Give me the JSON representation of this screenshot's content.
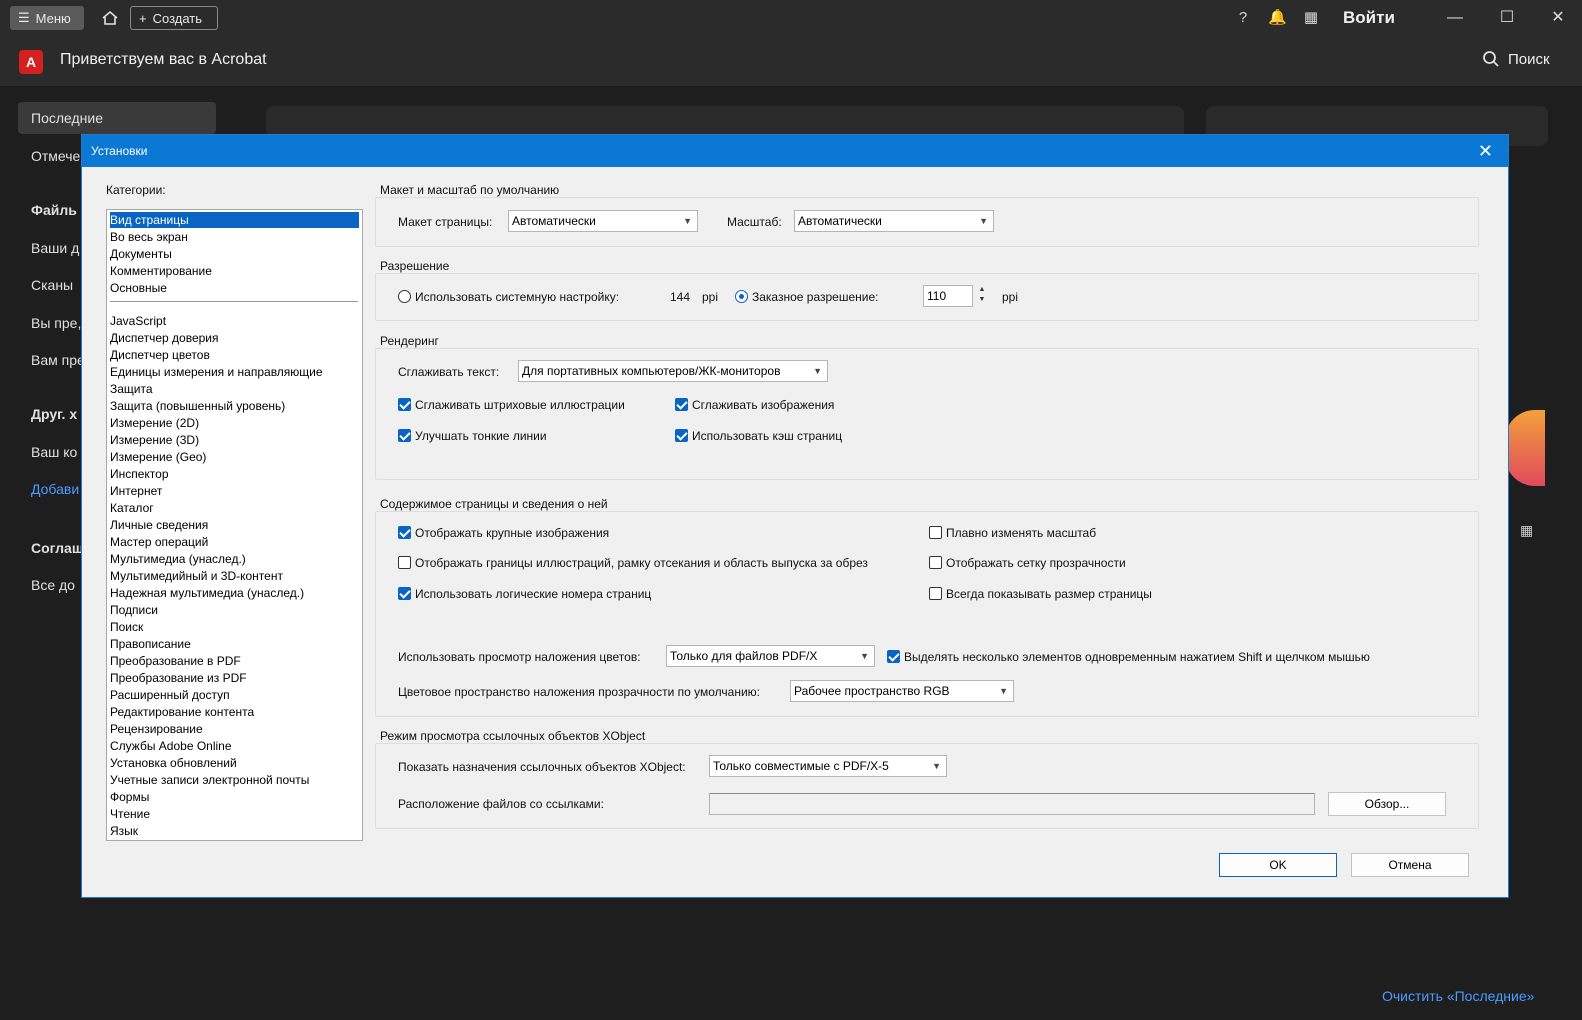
{
  "titlebar": {
    "menu_label": "Меню",
    "create_label": "Создать",
    "signin_label": "Войти",
    "icons": [
      "help-icon",
      "bell-icon",
      "apps-icon",
      "minimize-icon",
      "maximize-icon",
      "close-icon"
    ]
  },
  "appbar": {
    "title": "Приветствуем вас в Acrobat",
    "search_label": "Поиск"
  },
  "sidebar": {
    "items": [
      "Последние",
      "Отмече",
      "Файль",
      "Ваши д",
      "Сканы",
      "Вы пре,",
      "Вам пре",
      "Друг. х",
      "Ваш ко",
      "Добави",
      "Соглаш",
      "Все до"
    ]
  },
  "background": {
    "clear_recent": "Очистить «Последние»"
  },
  "dialog": {
    "title": "Установки",
    "categories_label": "Категории:",
    "categories_top": [
      "Вид страницы",
      "Во весь экран",
      "Документы",
      "Комментирование",
      "Основные"
    ],
    "categories": [
      "JavaScript",
      "Диспетчер доверия",
      "Диспетчер цветов",
      "Единицы измерения и направляющие",
      "Защита",
      "Защита (повышенный уровень)",
      "Измерение (2D)",
      "Измерение (3D)",
      "Измерение (Geo)",
      "Инспектор",
      "Интернет",
      "Каталог",
      "Личные сведения",
      "Мастер операций",
      "Мультимедиа (унаслед.)",
      "Мультимедийный и 3D-контент",
      "Надежная мультимедиа (унаслед.)",
      "Подписи",
      "Поиск",
      "Правописание",
      "Преобразование в PDF",
      "Преобразование из PDF",
      "Расширенный доступ",
      "Редактирование контента",
      "Рецензирование",
      "Службы Adobe Online",
      "Установка обновлений",
      "Учетные записи электронной почты",
      "Формы",
      "Чтение",
      "Язык"
    ],
    "layout": {
      "title": "Макет и масштаб по умолчанию",
      "page_layout_label": "Макет страницы:",
      "page_layout_value": "Автоматически",
      "zoom_label": "Масштаб:",
      "zoom_value": "Автоматически"
    },
    "resolution": {
      "title": "Разрешение",
      "system_label": "Использовать системную настройку:",
      "system_value": "144",
      "system_unit": "ppi",
      "custom_label": "Заказное разрешение:",
      "custom_value": "110",
      "custom_unit": "ppi",
      "selected": "custom"
    },
    "rendering": {
      "title": "Рендеринг",
      "smooth_text_label": "Сглаживать текст:",
      "smooth_text_value": "Для портативных компьютеров/ЖК-мониторов",
      "smooth_lineart": {
        "label": "Сглаживать штриховые иллюстрации",
        "checked": true
      },
      "smooth_images": {
        "label": "Сглаживать изображения",
        "checked": true
      },
      "enhance_thin": {
        "label": "Улучшать тонкие линии",
        "checked": true
      },
      "page_cache": {
        "label": "Использовать кэш страниц",
        "checked": true
      }
    },
    "content": {
      "title": "Содержимое страницы и сведения о ней",
      "large_images": {
        "label": "Отображать крупные изображения",
        "checked": true
      },
      "smooth_zoom": {
        "label": "Плавно изменять масштаб",
        "checked": false
      },
      "art_boxes": {
        "label": "Отображать границы иллюстраций, рамку отсекания и область выпуска за обрез",
        "checked": false
      },
      "transparency_grid": {
        "label": "Отображать сетку прозрачности",
        "checked": false
      },
      "logical_numbers": {
        "label": "Использовать логические номера страниц",
        "checked": true
      },
      "page_size": {
        "label": "Всегда показывать размер страницы",
        "checked": false
      },
      "overprint_label": "Использовать просмотр наложения цветов:",
      "overprint_value": "Только для файлов PDF/X",
      "shift_select": {
        "label": "Выделять несколько элементов одновременным нажатием Shift и щелчком мышью",
        "checked": true
      },
      "blend_space_label": "Цветовое пространство наложения прозрачности по умолчанию:",
      "blend_space_value": "Рабочее пространство RGB"
    },
    "xobject": {
      "title": "Режим просмотра ссылочных объектов XObject",
      "show_targets_label": "Показать назначения ссылочных объектов XObject:",
      "show_targets_value": "Только совместимые с PDF/X-5",
      "location_label": "Расположение файлов со ссылками:",
      "location_value": "",
      "browse_label": "Обзор..."
    },
    "ok_label": "OK",
    "cancel_label": "Отмена"
  }
}
